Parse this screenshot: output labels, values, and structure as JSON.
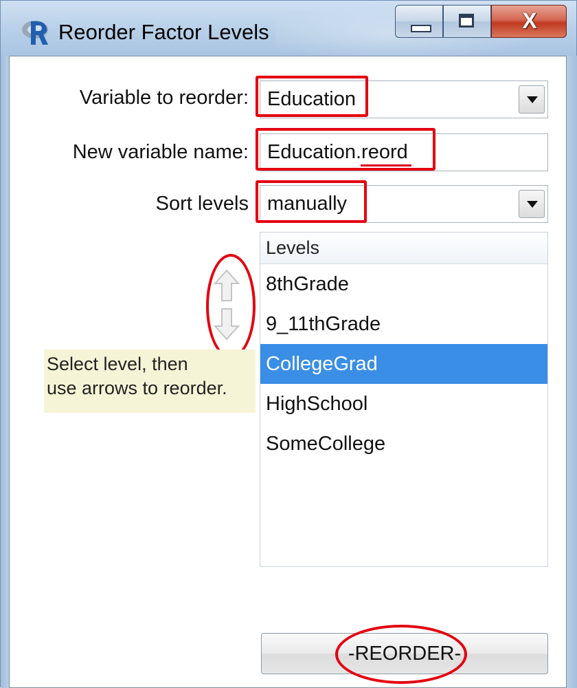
{
  "window": {
    "title": "Reorder Factor Levels",
    "app_icon": "r-logo-icon",
    "controls": [
      "minimize-icon",
      "maximize-icon",
      "close-icon"
    ],
    "close_glyph": "X"
  },
  "form": {
    "variable_label": "Variable to reorder:",
    "variable_value": "Education",
    "new_name_label": "New variable name:",
    "new_name_value": "Education.reord",
    "sort_label": "Sort levels",
    "sort_value": "manually"
  },
  "levels": {
    "header": "Levels",
    "items": [
      {
        "label": "8thGrade",
        "selected": false
      },
      {
        "label": "9_11thGrade",
        "selected": false
      },
      {
        "label": "CollegeGrad",
        "selected": true
      },
      {
        "label": "HighSchool",
        "selected": false
      },
      {
        "label": "SomeCollege",
        "selected": false
      }
    ]
  },
  "arrows": {
    "up_icon": "arrow-up-icon",
    "down_icon": "arrow-down-icon"
  },
  "hint": {
    "line1": "Select level, then",
    "line2": "use arrows to reorder."
  },
  "actions": {
    "reorder_label": "-REORDER-"
  },
  "colors": {
    "annotation_red": "#e4000f",
    "selection_blue": "#3a8ee6",
    "hint_background": "#f6f4d6"
  }
}
